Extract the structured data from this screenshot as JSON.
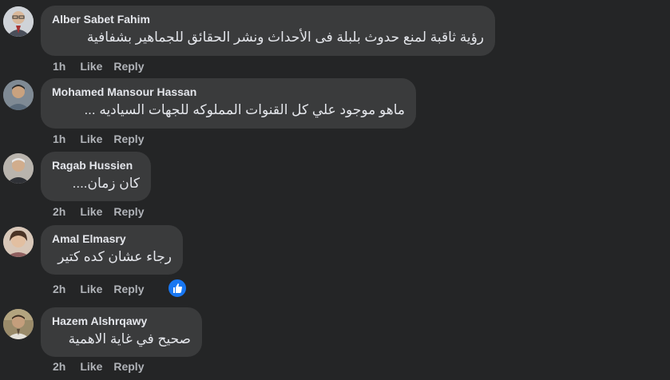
{
  "comments": [
    {
      "name": "Alber Sabet Fahim",
      "text": "رؤية ثاقبة لمنع حدوث بلبلة فى الأحداث ونشر الحقائق للجماهير بشفافية",
      "time": "1h",
      "like": "Like",
      "reply": "Reply",
      "avatar": "avatar-man-glasses"
    },
    {
      "name": "Mohamed Mansour Hassan",
      "text": "ماهو موجود علي كل القنوات المملوكه للجهات السياديه ...",
      "time": "1h",
      "like": "Like",
      "reply": "Reply",
      "avatar": "avatar-man"
    },
    {
      "name": "Ragab Hussien",
      "text": "كان زمان....",
      "time": "2h",
      "like": "Like",
      "reply": "Reply",
      "avatar": "avatar-older-man"
    },
    {
      "name": "Amal Elmasry",
      "text": "رجاء عشان كده كتير",
      "time": "2h",
      "like": "Like",
      "reply": "Reply",
      "avatar": "avatar-woman",
      "reaction": "thumbs-up-icon"
    },
    {
      "name": "Hazem Alshrqawy",
      "text": "صحيح في غاية الاهمية",
      "time": "2h",
      "like": "Like",
      "reply": "Reply",
      "avatar": "avatar-man-outdoor"
    }
  ],
  "colors": {
    "background": "#242526",
    "bubble": "#3a3b3c",
    "text": "#e4e6eb",
    "secondary": "#b0b3b8",
    "like_blue": "#1877f2"
  }
}
